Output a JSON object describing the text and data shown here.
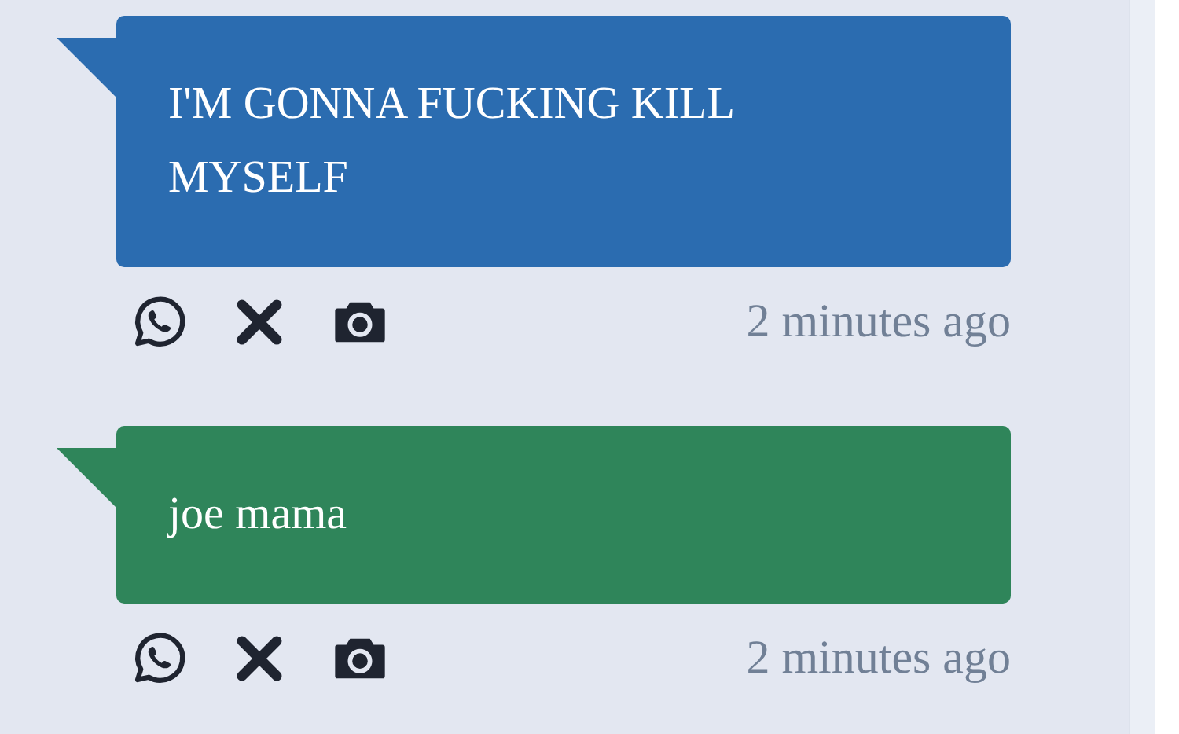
{
  "messages": [
    {
      "text": "I'M GONNA FUCKING KILL MYSELF",
      "color": "#2b6cb0",
      "time": "2 minutes ago"
    },
    {
      "text": "joe mama",
      "color": "#2f855a",
      "time": "2 minutes ago"
    }
  ]
}
